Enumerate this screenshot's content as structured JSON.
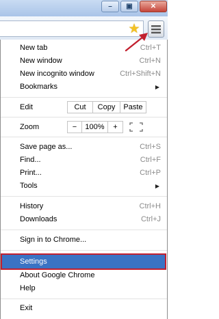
{
  "window_controls": {
    "minimize": "–",
    "restore": "▣",
    "close": "✕"
  },
  "toolbar": {
    "bookmark_star": "star-icon",
    "menu_button": "hamburger-menu-icon"
  },
  "menu": {
    "group1": [
      {
        "label": "New tab",
        "shortcut": "Ctrl+T"
      },
      {
        "label": "New window",
        "shortcut": "Ctrl+N"
      },
      {
        "label": "New incognito window",
        "shortcut": "Ctrl+Shift+N"
      },
      {
        "label": "Bookmarks",
        "shortcut": "▶"
      }
    ],
    "edit": {
      "label": "Edit",
      "cut": "Cut",
      "copy": "Copy",
      "paste": "Paste"
    },
    "zoom": {
      "label": "Zoom",
      "minus": "−",
      "level": "100%",
      "plus": "+"
    },
    "group2": [
      {
        "label": "Save page as...",
        "shortcut": "Ctrl+S"
      },
      {
        "label": "Find...",
        "shortcut": "Ctrl+F"
      },
      {
        "label": "Print...",
        "shortcut": "Ctrl+P"
      },
      {
        "label": "Tools",
        "shortcut": "▶"
      }
    ],
    "group3": [
      {
        "label": "History",
        "shortcut": "Ctrl+H"
      },
      {
        "label": "Downloads",
        "shortcut": "Ctrl+J"
      }
    ],
    "signin": "Sign in to Chrome...",
    "group4": [
      {
        "label": "Settings",
        "highlighted": true
      },
      {
        "label": "About Google Chrome"
      },
      {
        "label": "Help"
      }
    ],
    "exit": "Exit"
  },
  "colors": {
    "highlight": "#3a73c4",
    "highlight_border": "#c21f2e",
    "pointer_arrow": "#c21f2e",
    "star": "#f3c225"
  }
}
